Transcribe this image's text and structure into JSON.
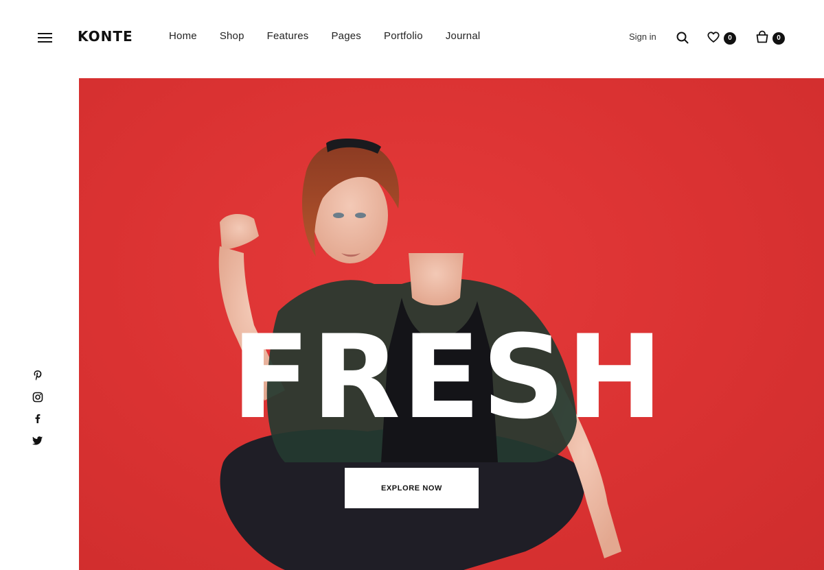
{
  "brand": {
    "logo_text": "KONTE"
  },
  "nav": {
    "items": [
      {
        "label": "Home"
      },
      {
        "label": "Shop"
      },
      {
        "label": "Features"
      },
      {
        "label": "Pages"
      },
      {
        "label": "Portfolio"
      },
      {
        "label": "Journal"
      }
    ]
  },
  "account": {
    "signin_label": "Sign in",
    "wishlist_count": "0",
    "cart_count": "0"
  },
  "social": {
    "icons": [
      "pinterest-icon",
      "instagram-icon",
      "facebook-icon",
      "twitter-icon"
    ]
  },
  "hero": {
    "headline": "FRESH",
    "cta_label": "EXPLORE NOW",
    "background_color": "#da3232"
  },
  "colors": {
    "accent": "#da3232",
    "text": "#111111",
    "badge": "#111111"
  }
}
